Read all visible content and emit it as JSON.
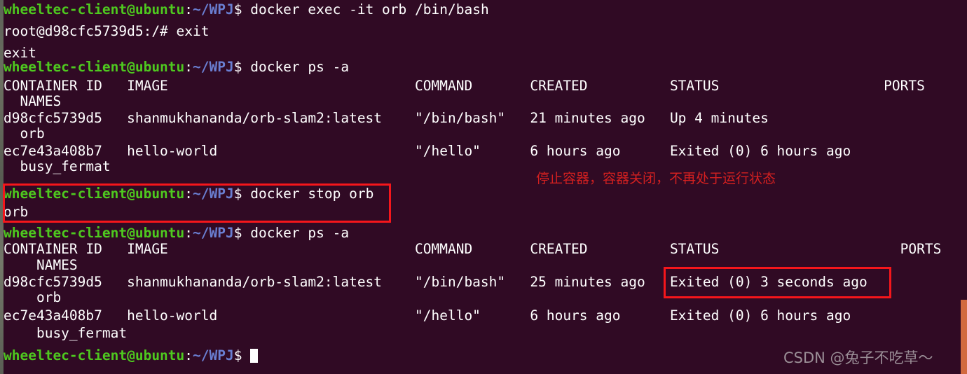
{
  "terminal": {
    "background_color": "#300a24",
    "prompt": {
      "user_host": "wheeltec-client@ubuntu",
      "colon": ":",
      "path": "~/WPJ",
      "sigil": "$ "
    },
    "root_prompt": "root@d98cfc5739d5:/# ",
    "lines": [
      {
        "id": "l1",
        "type": "prompt",
        "command": "docker exec -it orb /bin/bash"
      },
      {
        "id": "l2",
        "type": "root",
        "command": "exit"
      },
      {
        "id": "l3",
        "type": "output",
        "text": "exit"
      },
      {
        "id": "l4",
        "type": "prompt",
        "command": "docker ps -a"
      },
      {
        "id": "l5",
        "type": "output",
        "text": "CONTAINER ID   IMAGE                              COMMAND       CREATED          STATUS                    PORTS"
      },
      {
        "id": "l6",
        "type": "output",
        "text": "  NAMES"
      },
      {
        "id": "l7",
        "type": "output",
        "text": "d98cfc5739d5   shanmukhananda/orb-slam2:latest    \"/bin/bash\"   21 minutes ago   Up 4 minutes"
      },
      {
        "id": "l8",
        "type": "output",
        "text": "  orb"
      },
      {
        "id": "l9",
        "type": "output",
        "text": "ec7e43a408b7   hello-world                        \"/hello\"      6 hours ago      Exited (0) 6 hours ago"
      },
      {
        "id": "l10",
        "type": "output",
        "text": "  busy_fermat"
      },
      {
        "id": "l11",
        "type": "prompt",
        "command": "docker stop orb"
      },
      {
        "id": "l12",
        "type": "output",
        "text": "orb"
      },
      {
        "id": "l13",
        "type": "prompt",
        "command": "docker ps -a"
      },
      {
        "id": "l14",
        "type": "output",
        "text": "CONTAINER ID   IMAGE                              COMMAND       CREATED          STATUS                      PORTS"
      },
      {
        "id": "l15",
        "type": "output",
        "text": "    NAMES"
      },
      {
        "id": "l16",
        "type": "output",
        "text": "d98cfc5739d5   shanmukhananda/orb-slam2:latest    \"/bin/bash\"   25 minutes ago   Exited (0) 3 seconds ago"
      },
      {
        "id": "l17",
        "type": "output",
        "text": "    orb"
      },
      {
        "id": "l18",
        "type": "output",
        "text": "ec7e43a408b7   hello-world                        \"/hello\"      6 hours ago      Exited (0) 6 hours ago"
      },
      {
        "id": "l19",
        "type": "output",
        "text": "    busy_fermat"
      },
      {
        "id": "l20",
        "type": "prompt-cursor",
        "command": ""
      }
    ],
    "table_headers": [
      "CONTAINER ID",
      "IMAGE",
      "COMMAND",
      "CREATED",
      "STATUS",
      "PORTS",
      "NAMES"
    ],
    "containers": [
      {
        "container_id": "d98cfc5739d5",
        "image": "shanmukhananda/orb-slam2:latest",
        "command": "\"/bin/bash\"",
        "created_before": "21 minutes ago",
        "status_before": "Up 4 minutes",
        "created_after": "25 minutes ago",
        "status_after": "Exited (0) 3 seconds ago",
        "ports": "",
        "names": "orb"
      },
      {
        "container_id": "ec7e43a408b7",
        "image": "hello-world",
        "command": "\"/hello\"",
        "created_before": "6 hours ago",
        "status_before": "Exited (0) 6 hours ago",
        "created_after": "6 hours ago",
        "status_after": "Exited (0) 6 hours ago",
        "ports": "",
        "names": "busy_fermat"
      }
    ]
  },
  "annotations": {
    "note_text": "停止容器，容器关闭，不再处于运行状态",
    "note_color": "#d32020",
    "box_color": "#f5161b"
  },
  "watermark": {
    "text": "CSDN @兔子不吃草～"
  }
}
